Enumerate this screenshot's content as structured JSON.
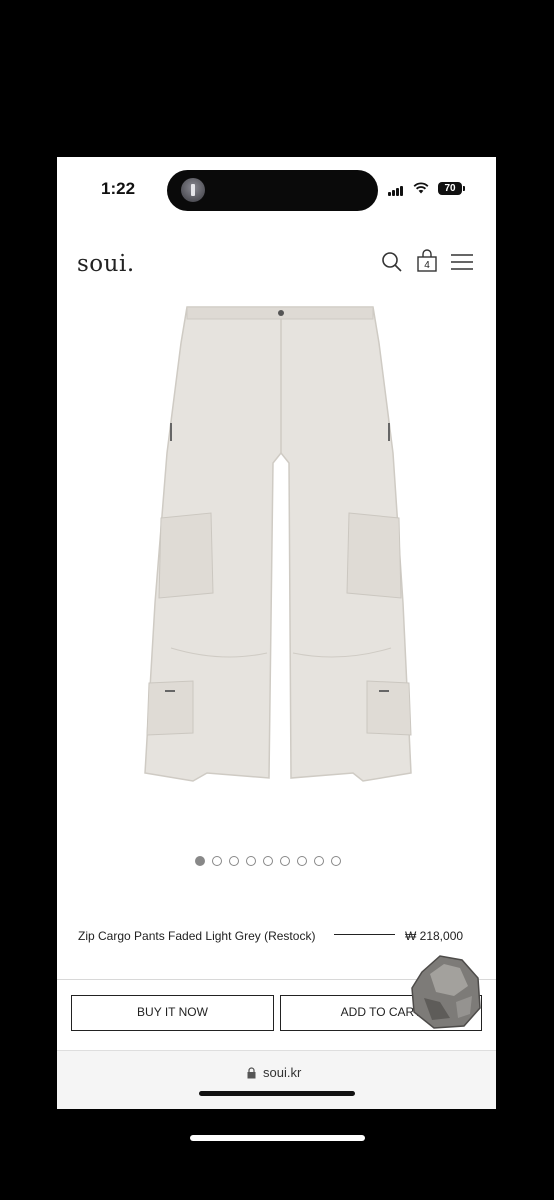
{
  "status_bar": {
    "time": "1:22",
    "battery": "70"
  },
  "header": {
    "logo": "soui.",
    "cart_count": "4"
  },
  "product": {
    "name": "Zip Cargo Pants Faded Light Grey (Restock)",
    "price": "₩ 218,000",
    "image_count": 9,
    "active_image": 1
  },
  "actions": {
    "buy_now": "BUY IT NOW",
    "add_to_cart": "ADD TO CART"
  },
  "browser": {
    "url": "soui.kr"
  },
  "icons": [
    "search-icon",
    "cart-icon",
    "menu-icon",
    "lock-icon",
    "wifi-icon",
    "signal-icon"
  ],
  "colors": {
    "background": "#000000",
    "screen": "#ffffff",
    "text": "#222222",
    "pants": "#e6e3de"
  }
}
